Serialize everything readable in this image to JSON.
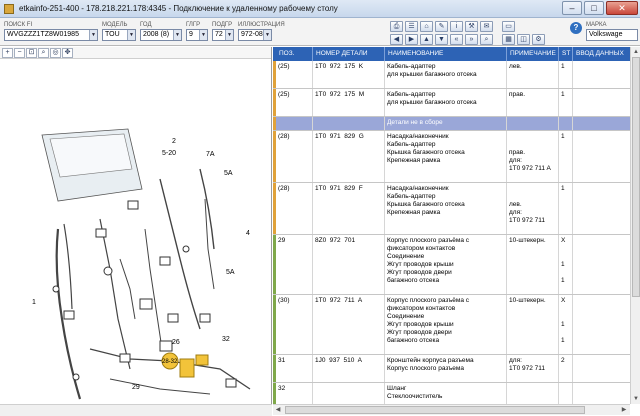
{
  "window": {
    "title": "etkainfo-251-400 - 178.218.221.178:4345 - Подключение к удаленному рабочему столу",
    "minimize": "–",
    "maximize": "□",
    "close": "✕"
  },
  "toolbar": {
    "fields": [
      {
        "label": "ПОИСК FI",
        "value": "WVGZZZ1TZ8W01985",
        "dropdown": true
      },
      {
        "label": "МОДЕЛЬ",
        "value": "TOU",
        "dropdown": true
      },
      {
        "label": "ГОД",
        "value": "2008 (8)",
        "dropdown": true
      },
      {
        "label": "ГЛГР",
        "value": "9",
        "dropdown": true
      },
      {
        "label": "ПОДГР",
        "value": "72",
        "dropdown": true
      },
      {
        "label": "ИЛЛЮСТРАЦИЯ",
        "value": "972-08",
        "dropdown": true
      },
      {
        "label": "МАРКА",
        "value": "Volkswage",
        "dropdown": false
      }
    ],
    "help": "?"
  },
  "diagram": {
    "callouts": [
      "2",
      "5-20",
      "5A",
      "7A",
      "4",
      "5A",
      "1",
      "26",
      "28-32",
      "32",
      "29",
      "7B",
      "5-20"
    ]
  },
  "grid": {
    "columns": [
      "ПОЗ.",
      "НОМЕР ДЕТАЛИ",
      "НАИМЕНОВАНИЕ",
      "ПРИМЕЧАНИЕ",
      "ST",
      "ВВОД ДАННЫХ"
    ],
    "rows": [
      {
        "pos": "(25)",
        "part": "1T0  972  175  K",
        "name": "Кабель-адаптер\nдля крышки багажного отсека",
        "note": "лев.",
        "st": "1",
        "mark": "#e0a23a"
      },
      {
        "pos": "(25)",
        "part": "1T0  972  175  M",
        "name": "Кабель-адаптер\nдля крышки багажного отсека",
        "note": "прав.",
        "st": "1",
        "mark": "#e0a23a"
      },
      {
        "pos": "",
        "part": "",
        "name": "Детали не в сборе",
        "note": "",
        "st": "",
        "mark": "#e0a23a",
        "section": true
      },
      {
        "pos": "(28)",
        "part": "1T0  971  829  G",
        "name": "Насадка/наконечник\nКабель-адаптер\nКрышка багажного отсека\nКрепежная рамка",
        "note": "\n\nправ.\nдля:\n1T0 972 711 A",
        "st": "1",
        "mark": "#e0a23a"
      },
      {
        "pos": "(28)",
        "part": "1T0  971  829  F",
        "name": "Насадка/наконечник\nКабель-адаптер\nКрышка багажного отсека\nКрепежная рамка",
        "note": "\n\nлев.\nдля:\n1T0 972 711",
        "st": "1",
        "mark": "#e0a23a"
      },
      {
        "pos": "29",
        "part": "8Z0  972  701",
        "name": "Корпус плоского разъёма с\nфиксатором контактов\nСоединение\nЖгут проводов крыши\nЖгут проводов двери\nбагажного отсека",
        "note": "10-штекерн.",
        "st": "X\n\n\n1\n\n1",
        "mark": "#7fa84a"
      },
      {
        "pos": "(30)",
        "part": "1T0  972  711  A",
        "name": "Корпус плоского разъёма с\nфиксатором контактов\nСоединение\nЖгут проводов крыши\nЖгут проводов двери\nбагажного отсека",
        "note": "10-штекерн.",
        "st": "X\n\n\n1\n\n1",
        "mark": "#7fa84a"
      },
      {
        "pos": "31",
        "part": "1J0  937  510  A",
        "name": "Кронштейн корпуса разъема\nКорпус плоского разъема",
        "note": "для:\n1T0 972 711",
        "st": "2",
        "mark": "#7fa84a"
      },
      {
        "pos": "32",
        "part": "",
        "name": "Шланг\nСтеклоочиститель",
        "note": "",
        "st": "",
        "mark": "#7fa84a"
      }
    ]
  }
}
